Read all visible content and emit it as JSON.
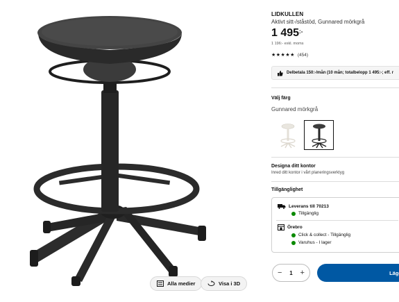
{
  "media": {
    "all_media_label": "Alla medier",
    "view_3d_label": "Visa i 3D"
  },
  "product": {
    "name": "LIDKULLEN",
    "description": "Aktivt sitt-/ståstöd, Gunnared mörkgrå",
    "price": "1 495",
    "price_suffix": ":-",
    "price_ex_vat": "1 196:- exkl. moms",
    "rating_stars": "★★★★★",
    "review_count": "(454)"
  },
  "installment": {
    "text": "Delbetala 150:-/mån (10 mån; totalbelopp 1 495:-; eff. r"
  },
  "color": {
    "heading": "Välj färg",
    "selected": "Gunnared mörkgrå"
  },
  "office": {
    "heading": "Designa ditt kontor",
    "text": "Inred ditt kontor i vårt planeringsverktyg"
  },
  "availability": {
    "heading": "Tillgänglighet",
    "delivery_label": "Leverans till 70213",
    "delivery_status": "Tillgänglig",
    "store_label": "Örebro",
    "store_status_1": "Click & collect - Tillgänglig",
    "store_status_2": "Varuhus - I lager",
    "status_color": "#0a8a00"
  },
  "purchase": {
    "quantity": "1",
    "minus": "−",
    "plus": "+",
    "add_label": "Lägg"
  },
  "colors": {
    "accent": "#0058a3"
  }
}
